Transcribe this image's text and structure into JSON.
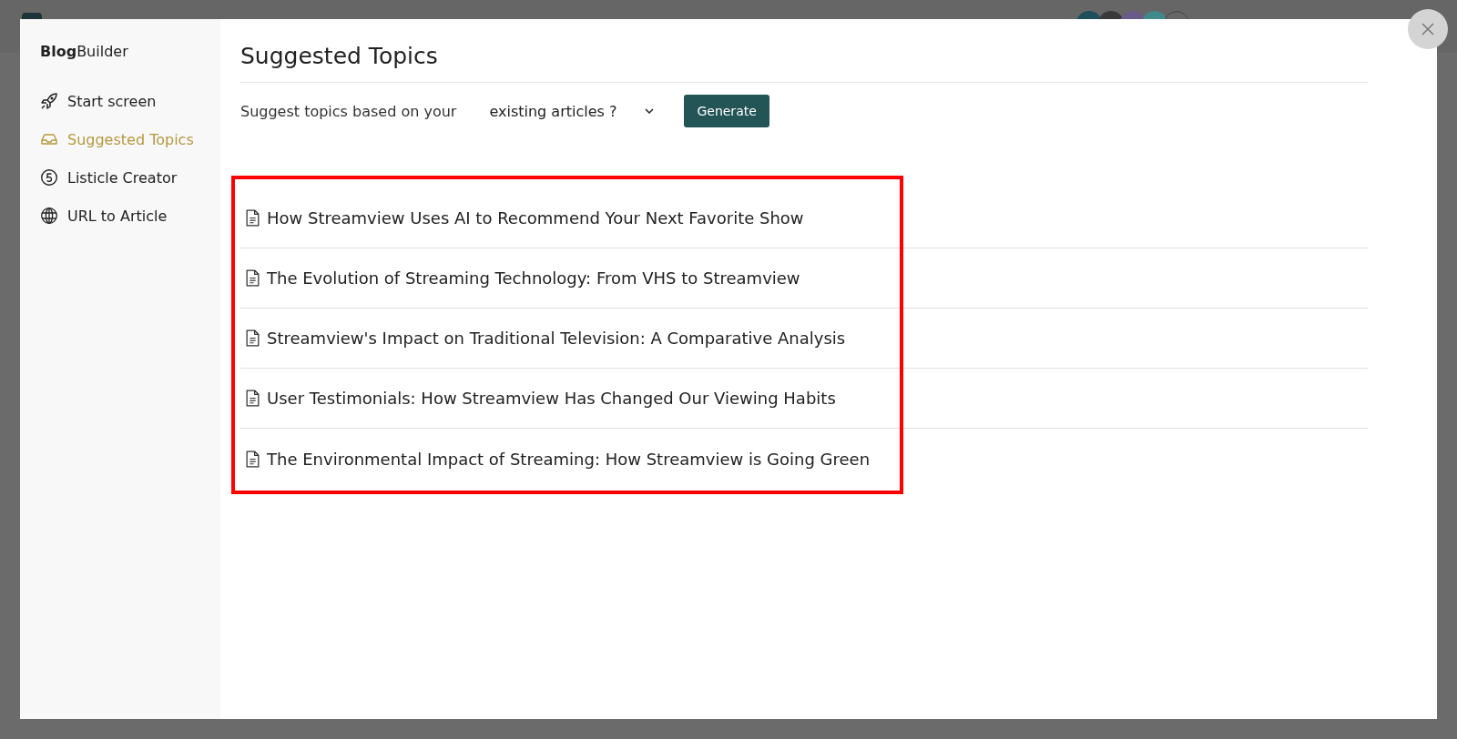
{
  "sidebar": {
    "brand_bold": "Blog",
    "brand_rest": "Builder",
    "items": [
      {
        "label": "Start screen",
        "selected": false
      },
      {
        "label": "Suggested Topics",
        "selected": true
      },
      {
        "label": "Listicle Creator",
        "selected": false
      },
      {
        "label": "URL to Article",
        "selected": false
      }
    ]
  },
  "main": {
    "title": "Suggested Topics",
    "prompt": "Suggest topics based on your",
    "select": {
      "value": "existing articles ?"
    },
    "button": "Generate",
    "topics": [
      "How Streamview Uses AI to Recommend Your Next Favorite Show",
      "The Evolution of Streaming Technology: From VHS to Streamview",
      "Streamview's Impact on Traditional Television: A Comparative Analysis",
      "User Testimonials: How Streamview Has Changed Our Viewing Habits",
      "The Environmental Impact of Streaming: How Streamview is Going Green"
    ]
  }
}
